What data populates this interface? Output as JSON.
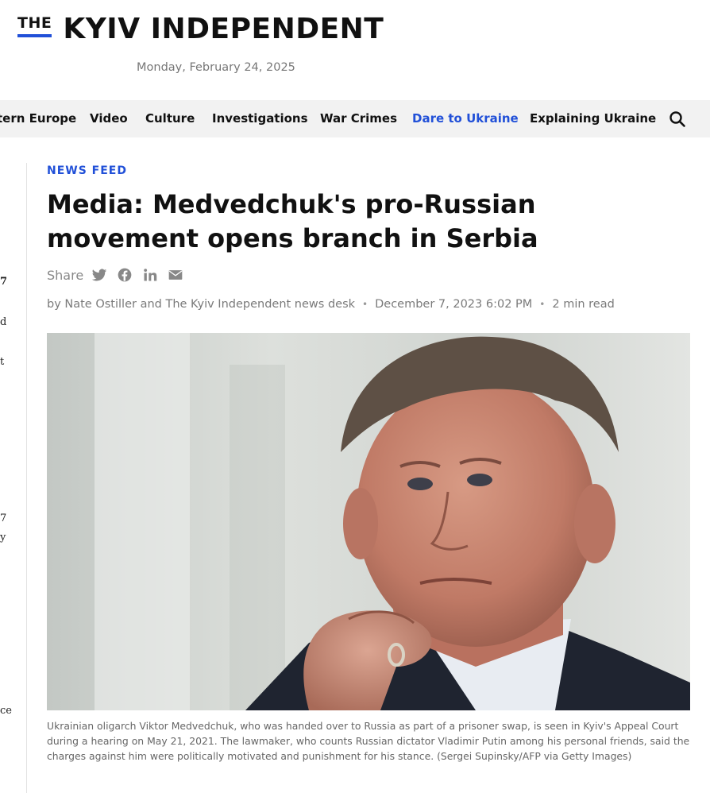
{
  "header": {
    "logo_the": "THE",
    "logo_name": "KYIV INDEPENDENT",
    "date": "Monday, February 24, 2025"
  },
  "nav": {
    "items": [
      {
        "label": "tern Europe",
        "active": false
      },
      {
        "label": "Video",
        "active": false
      },
      {
        "label": "Culture",
        "active": false
      },
      {
        "label": "Investigations",
        "active": false
      },
      {
        "label": "War Crimes",
        "active": false
      },
      {
        "label": "Dare to Ukraine",
        "active": true
      },
      {
        "label": "Explaining Ukraine",
        "active": false
      }
    ],
    "search_icon": "search-icon"
  },
  "left_fragments": [
    "7",
    "d",
    "t",
    "7",
    "y",
    "ce"
  ],
  "article": {
    "kicker": "NEWS FEED",
    "headline": "Media: Medvedchuk's pro-Russian movement opens branch in Serbia",
    "share_label": "Share",
    "share_icons": [
      "twitter-icon",
      "facebook-icon",
      "linkedin-icon",
      "mail-icon"
    ],
    "byline": {
      "authors": "by Nate Ostiller and The Kyiv Independent news desk",
      "date": "December 7, 2023 6:02 PM",
      "read_time": "2 min read"
    },
    "image_caption": "Ukrainian oligarch Viktor Medvedchuk, who was handed over to Russia as part of a prisoner swap, is seen in Kyiv's Appeal Court during a hearing on May 21, 2021. The lawmaker, who counts Russian dictator Vladimir Putin among his personal friends, said the charges against him were politically motivated and punishment for his stance. (Sergei Supinsky/AFP via Getty Images)"
  },
  "colors": {
    "accent_blue": "#2150d8",
    "nav_bg": "#f2f2f2",
    "meta_gray": "#7a7a7a"
  }
}
